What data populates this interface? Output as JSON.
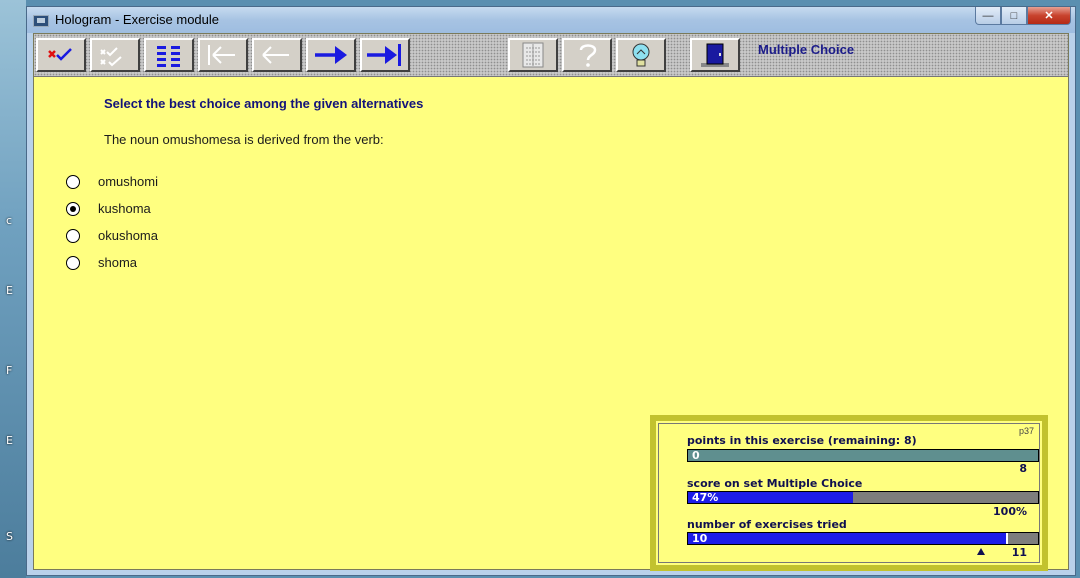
{
  "window": {
    "title": "Hologram - Exercise module"
  },
  "toolbar": {
    "buttons": [
      {
        "icon": "check-cross-icon"
      },
      {
        "icon": "check-disabled-icon"
      },
      {
        "icon": "list-icon"
      },
      {
        "icon": "first-disabled-icon"
      },
      {
        "icon": "prev-disabled-icon"
      },
      {
        "icon": "next-icon"
      },
      {
        "icon": "last-icon"
      },
      {
        "icon": "sheet-icon"
      },
      {
        "icon": "help-disabled-icon"
      },
      {
        "icon": "hint-bulb-icon"
      },
      {
        "icon": "exit-door-icon"
      }
    ],
    "mode_label": "Multiple Choice"
  },
  "exercise": {
    "instruction": "Select the best choice among the given alternatives",
    "question": "The noun omushomesa is derived from the verb:",
    "options": [
      {
        "label": "omushomi",
        "selected": false
      },
      {
        "label": "kushoma",
        "selected": true
      },
      {
        "label": "okushoma",
        "selected": false
      },
      {
        "label": "shoma",
        "selected": false
      }
    ]
  },
  "score_panel": {
    "page_ref": "p37",
    "points_label": "points in this exercise (remaining: 8)",
    "points_value": "0",
    "points_max": "8",
    "points_fraction": 0.0,
    "score_label": "score on set Multiple Choice",
    "score_value": "47%",
    "score_max": "100%",
    "score_fraction": 0.47,
    "tried_label": "number of exercises tried",
    "tried_value": "10",
    "tried_max": "11",
    "tried_fraction": 0.909
  },
  "colors": {
    "background": "#ffff80",
    "accent": "#1d1de8",
    "title": "#13137a"
  }
}
